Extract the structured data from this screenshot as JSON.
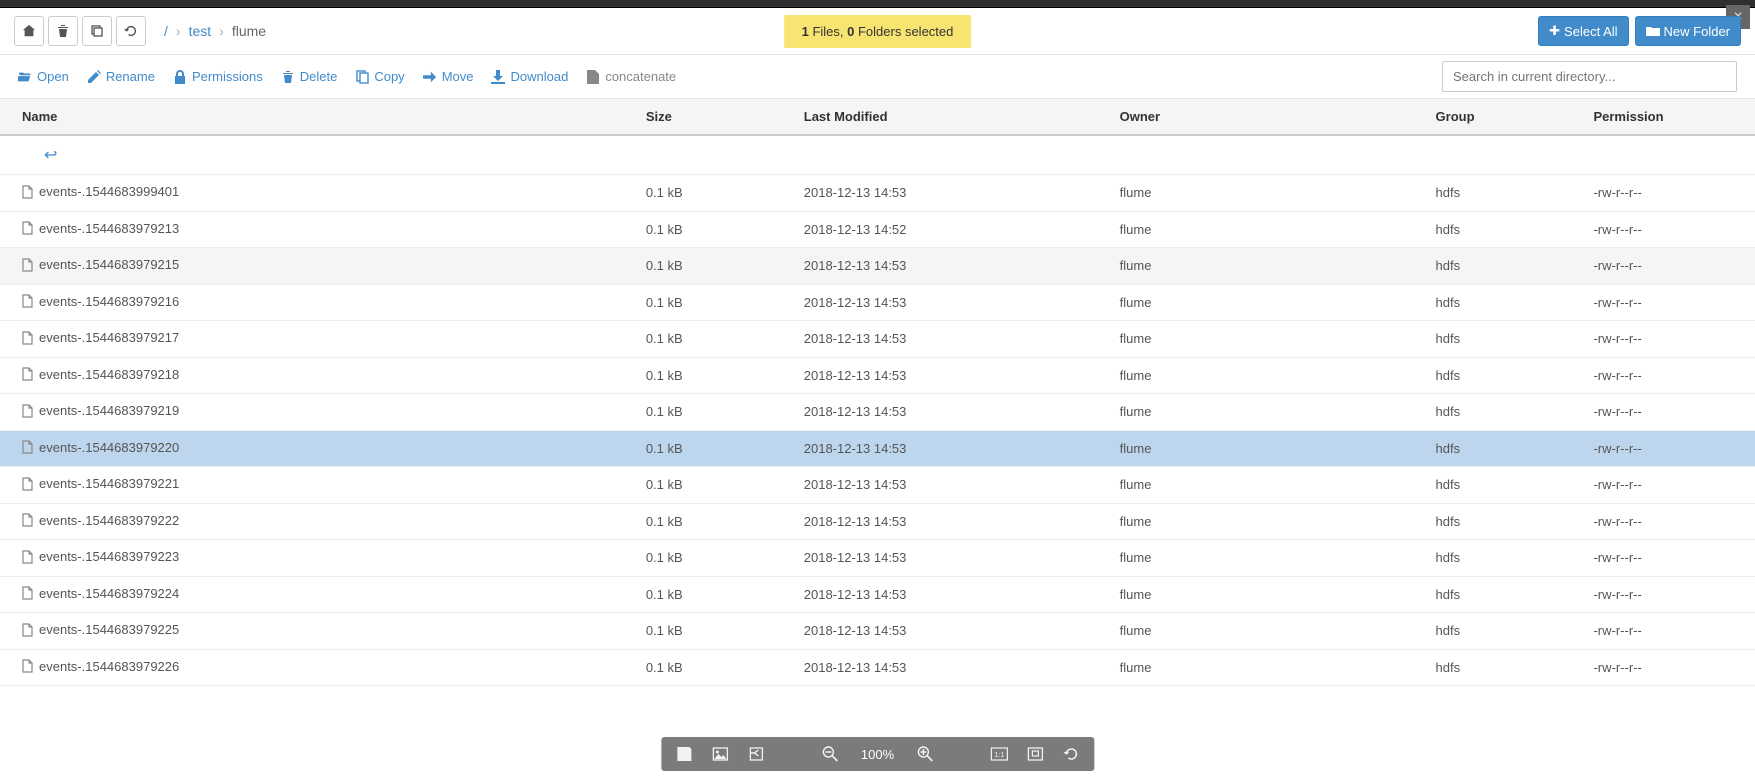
{
  "close_label": "×",
  "breadcrumb": {
    "root": "/",
    "parts": [
      "test"
    ],
    "current": "flume"
  },
  "selection": {
    "files": "1",
    "files_label": " Files, ",
    "folders": "0",
    "folders_label": " Folders selected"
  },
  "buttons": {
    "select_all": "Select All",
    "new_folder": "New Folder"
  },
  "actions": {
    "open": "Open",
    "rename": "Rename",
    "permissions": "Permissions",
    "delete": "Delete",
    "copy": "Copy",
    "move": "Move",
    "download": "Download",
    "concatenate": "concatenate"
  },
  "search": {
    "placeholder": "Search in current directory..."
  },
  "columns": {
    "name": "Name",
    "size": "Size",
    "modified": "Last Modified",
    "owner": "Owner",
    "group": "Group",
    "permission": "Permission"
  },
  "files": [
    {
      "name": "events-.1544683999401",
      "size": "0.1 kB",
      "modified": "2018-12-13 14:53",
      "owner": "flume",
      "group": "hdfs",
      "perm": "-rw-r--r--",
      "selected": false,
      "striped": false
    },
    {
      "name": "events-.1544683979213",
      "size": "0.1 kB",
      "modified": "2018-12-13 14:52",
      "owner": "flume",
      "group": "hdfs",
      "perm": "-rw-r--r--",
      "selected": false,
      "striped": false
    },
    {
      "name": "events-.1544683979215",
      "size": "0.1 kB",
      "modified": "2018-12-13 14:53",
      "owner": "flume",
      "group": "hdfs",
      "perm": "-rw-r--r--",
      "selected": false,
      "striped": true
    },
    {
      "name": "events-.1544683979216",
      "size": "0.1 kB",
      "modified": "2018-12-13 14:53",
      "owner": "flume",
      "group": "hdfs",
      "perm": "-rw-r--r--",
      "selected": false,
      "striped": false
    },
    {
      "name": "events-.1544683979217",
      "size": "0.1 kB",
      "modified": "2018-12-13 14:53",
      "owner": "flume",
      "group": "hdfs",
      "perm": "-rw-r--r--",
      "selected": false,
      "striped": false
    },
    {
      "name": "events-.1544683979218",
      "size": "0.1 kB",
      "modified": "2018-12-13 14:53",
      "owner": "flume",
      "group": "hdfs",
      "perm": "-rw-r--r--",
      "selected": false,
      "striped": false
    },
    {
      "name": "events-.1544683979219",
      "size": "0.1 kB",
      "modified": "2018-12-13 14:53",
      "owner": "flume",
      "group": "hdfs",
      "perm": "-rw-r--r--",
      "selected": false,
      "striped": false
    },
    {
      "name": "events-.1544683979220",
      "size": "0.1 kB",
      "modified": "2018-12-13 14:53",
      "owner": "flume",
      "group": "hdfs",
      "perm": "-rw-r--r--",
      "selected": true,
      "striped": false
    },
    {
      "name": "events-.1544683979221",
      "size": "0.1 kB",
      "modified": "2018-12-13 14:53",
      "owner": "flume",
      "group": "hdfs",
      "perm": "-rw-r--r--",
      "selected": false,
      "striped": false
    },
    {
      "name": "events-.1544683979222",
      "size": "0.1 kB",
      "modified": "2018-12-13 14:53",
      "owner": "flume",
      "group": "hdfs",
      "perm": "-rw-r--r--",
      "selected": false,
      "striped": false
    },
    {
      "name": "events-.1544683979223",
      "size": "0.1 kB",
      "modified": "2018-12-13 14:53",
      "owner": "flume",
      "group": "hdfs",
      "perm": "-rw-r--r--",
      "selected": false,
      "striped": false
    },
    {
      "name": "events-.1544683979224",
      "size": "0.1 kB",
      "modified": "2018-12-13 14:53",
      "owner": "flume",
      "group": "hdfs",
      "perm": "-rw-r--r--",
      "selected": false,
      "striped": false
    },
    {
      "name": "events-.1544683979225",
      "size": "0.1 kB",
      "modified": "2018-12-13 14:53",
      "owner": "flume",
      "group": "hdfs",
      "perm": "-rw-r--r--",
      "selected": false,
      "striped": false
    },
    {
      "name": "events-.1544683979226",
      "size": "0.1 kB",
      "modified": "2018-12-13 14:53",
      "owner": "flume",
      "group": "hdfs",
      "perm": "-rw-r--r--",
      "selected": false,
      "striped": false
    }
  ],
  "viewer": {
    "zoom": "100%"
  }
}
